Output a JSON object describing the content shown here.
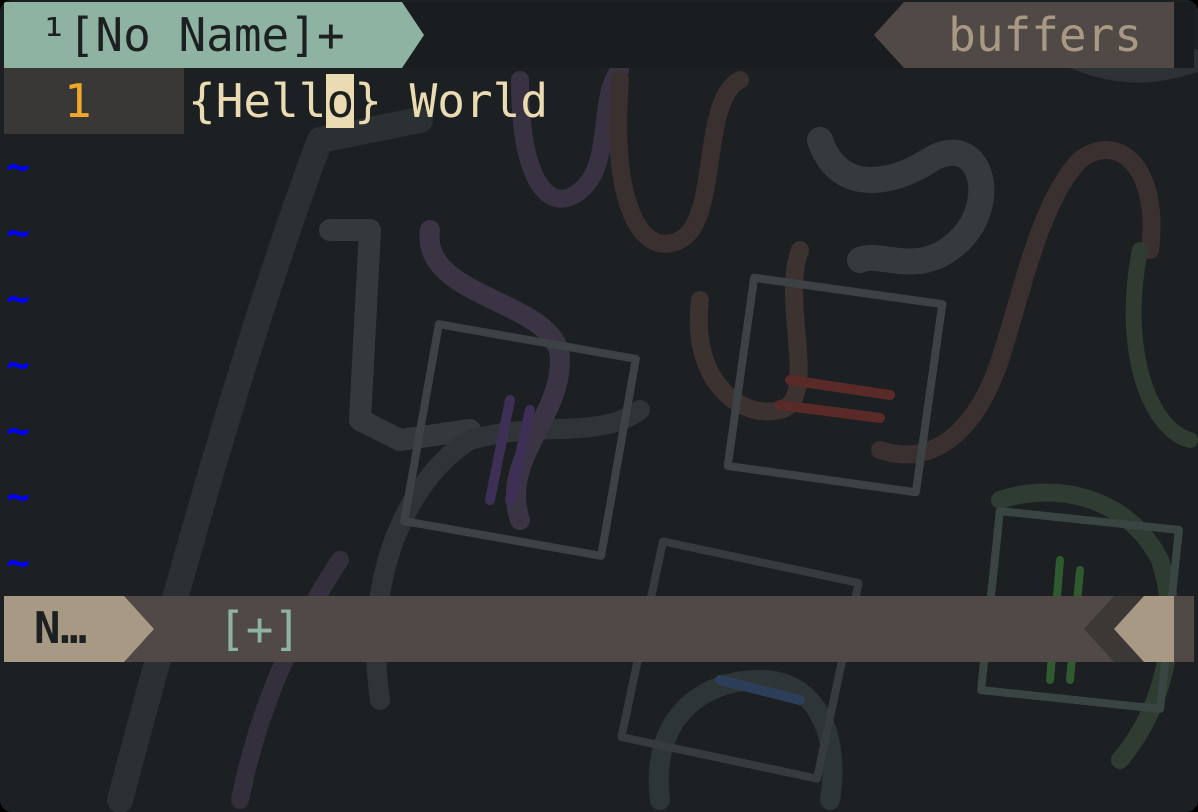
{
  "tabline": {
    "active_tab_label": "¹[No Name]+",
    "buffers_label": "buffers"
  },
  "buffer": {
    "line_number": "1",
    "text_before_cursor": "{Hell",
    "cursor_char": "o",
    "text_after_cursor": "} World",
    "empty_line_marker": "~"
  },
  "statusline": {
    "mode": "N…",
    "modified": "[+]"
  },
  "colors": {
    "tab_active_bg": "#8fb3a3",
    "buffers_bg": "#504945",
    "line_number": "#f0a82a",
    "text": "#ebdbb2",
    "tilde": "#0000ff",
    "mode_bg": "#a89984",
    "statusline_bg": "#504945"
  }
}
